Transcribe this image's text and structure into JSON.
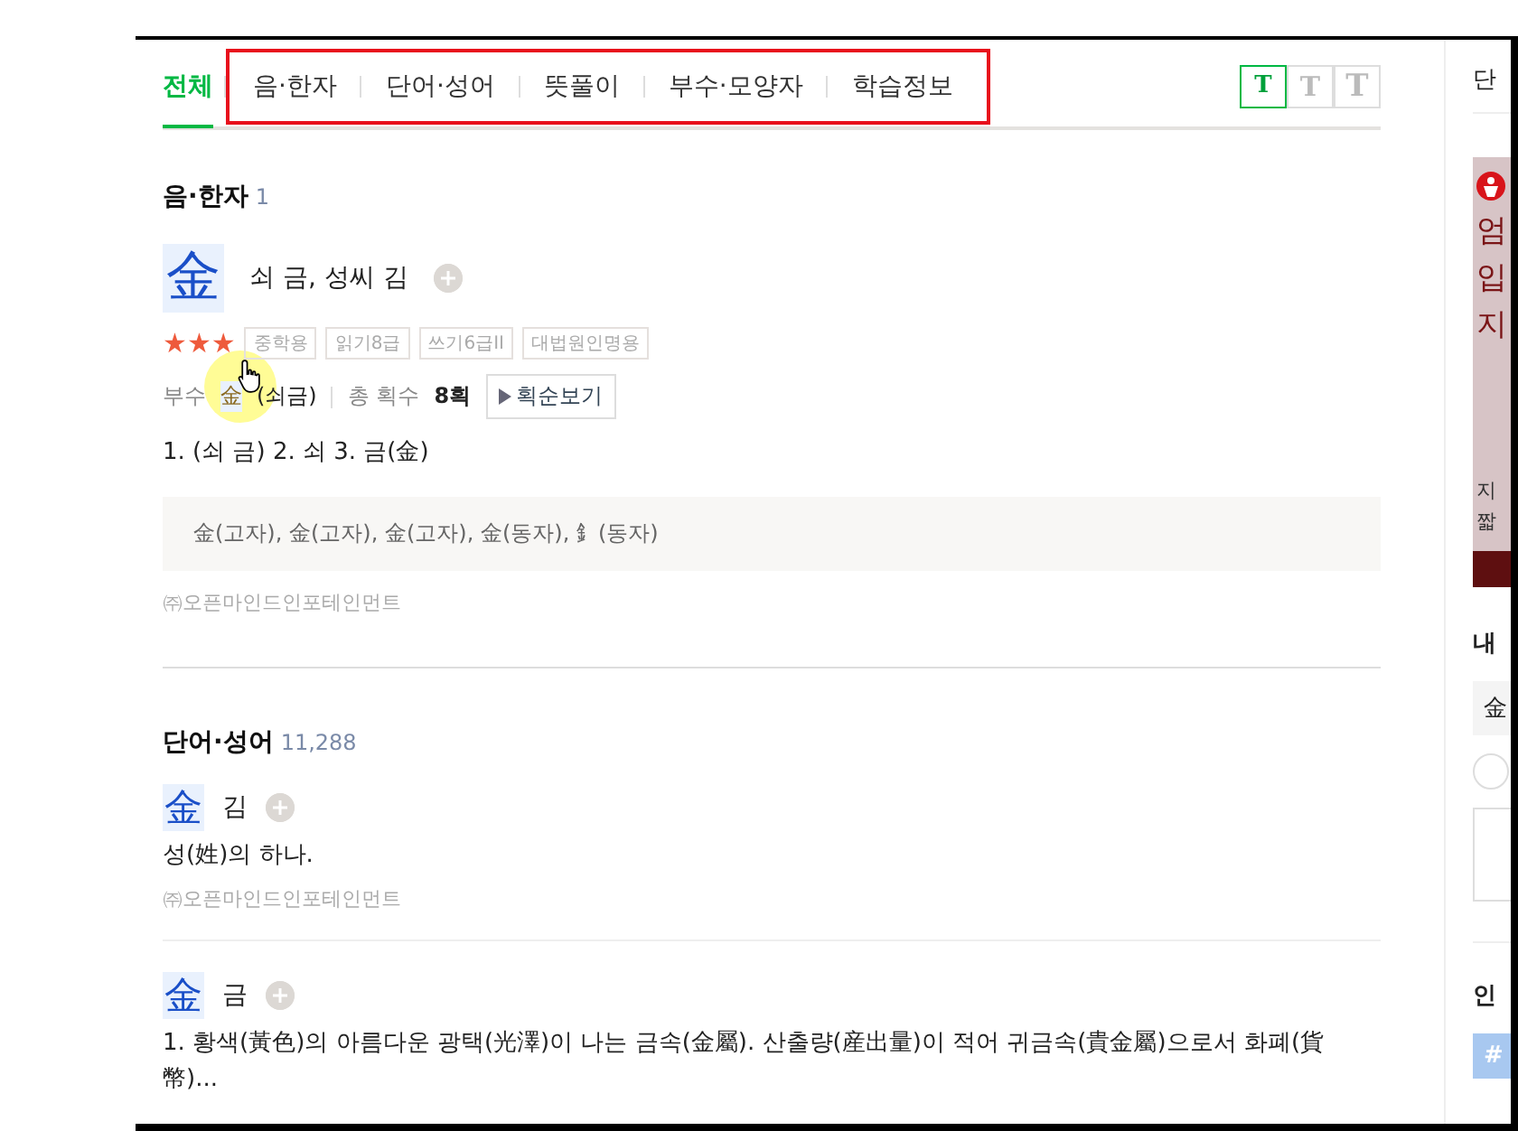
{
  "tabs": [
    {
      "label": "전체",
      "selected": true
    },
    {
      "label": "음·한자",
      "selected": false
    },
    {
      "label": "단어·성어",
      "selected": false
    },
    {
      "label": "뜻풀이",
      "selected": false
    },
    {
      "label": "부수·모양자",
      "selected": false
    },
    {
      "label": "학습정보",
      "selected": false
    }
  ],
  "font_size_buttons": [
    {
      "label": "T",
      "selected": true
    },
    {
      "label": "T",
      "selected": false
    },
    {
      "label": "T",
      "selected": false
    }
  ],
  "hanja_section": {
    "title": "음·한자",
    "count": "1",
    "entry": {
      "char": "金",
      "meaning": "쇠 금, 성씨 김",
      "stars": 3,
      "tags": [
        "중학용",
        "읽기8급",
        "쓰기6급II",
        "대법원인명용"
      ],
      "radical_label": "부수",
      "radical": "金",
      "radical_reading": "(쇠금)",
      "strokes_label": "총 획수",
      "strokes": "8획",
      "stroke_order_button": "획순보기",
      "readings": "1. (쇠 금)  2. 쇠  3. 금(金)",
      "variants": "金(고자), 金(고자), 金(고자), 金(동자), 釒(동자)",
      "source": "㈜오픈마인드인포테인먼트"
    }
  },
  "word_section": {
    "title": "단어·성어",
    "count": "11,288",
    "entries": [
      {
        "char": "金",
        "word": "김",
        "definition": "성(姓)의 하나.",
        "source": "㈜오픈마인드인포테인먼트"
      },
      {
        "char": "金",
        "word": "금",
        "definition": "1. 황색(黃色)의 아름다운 광택(光澤)이 나는 금속(金屬). 산출량(産出量)이 적어 귀금속(貴金屬)으로서 화폐(貨幣)..."
      }
    ]
  },
  "sidebar": {
    "tab": "단",
    "toggle_on": false,
    "ad_lines": [
      "엄",
      "입",
      "지"
    ],
    "ad_small_lines": [
      "지",
      "짧"
    ],
    "my_heading": "내",
    "my_field": "金",
    "popular_heading": "인",
    "popular_chip": "#"
  }
}
